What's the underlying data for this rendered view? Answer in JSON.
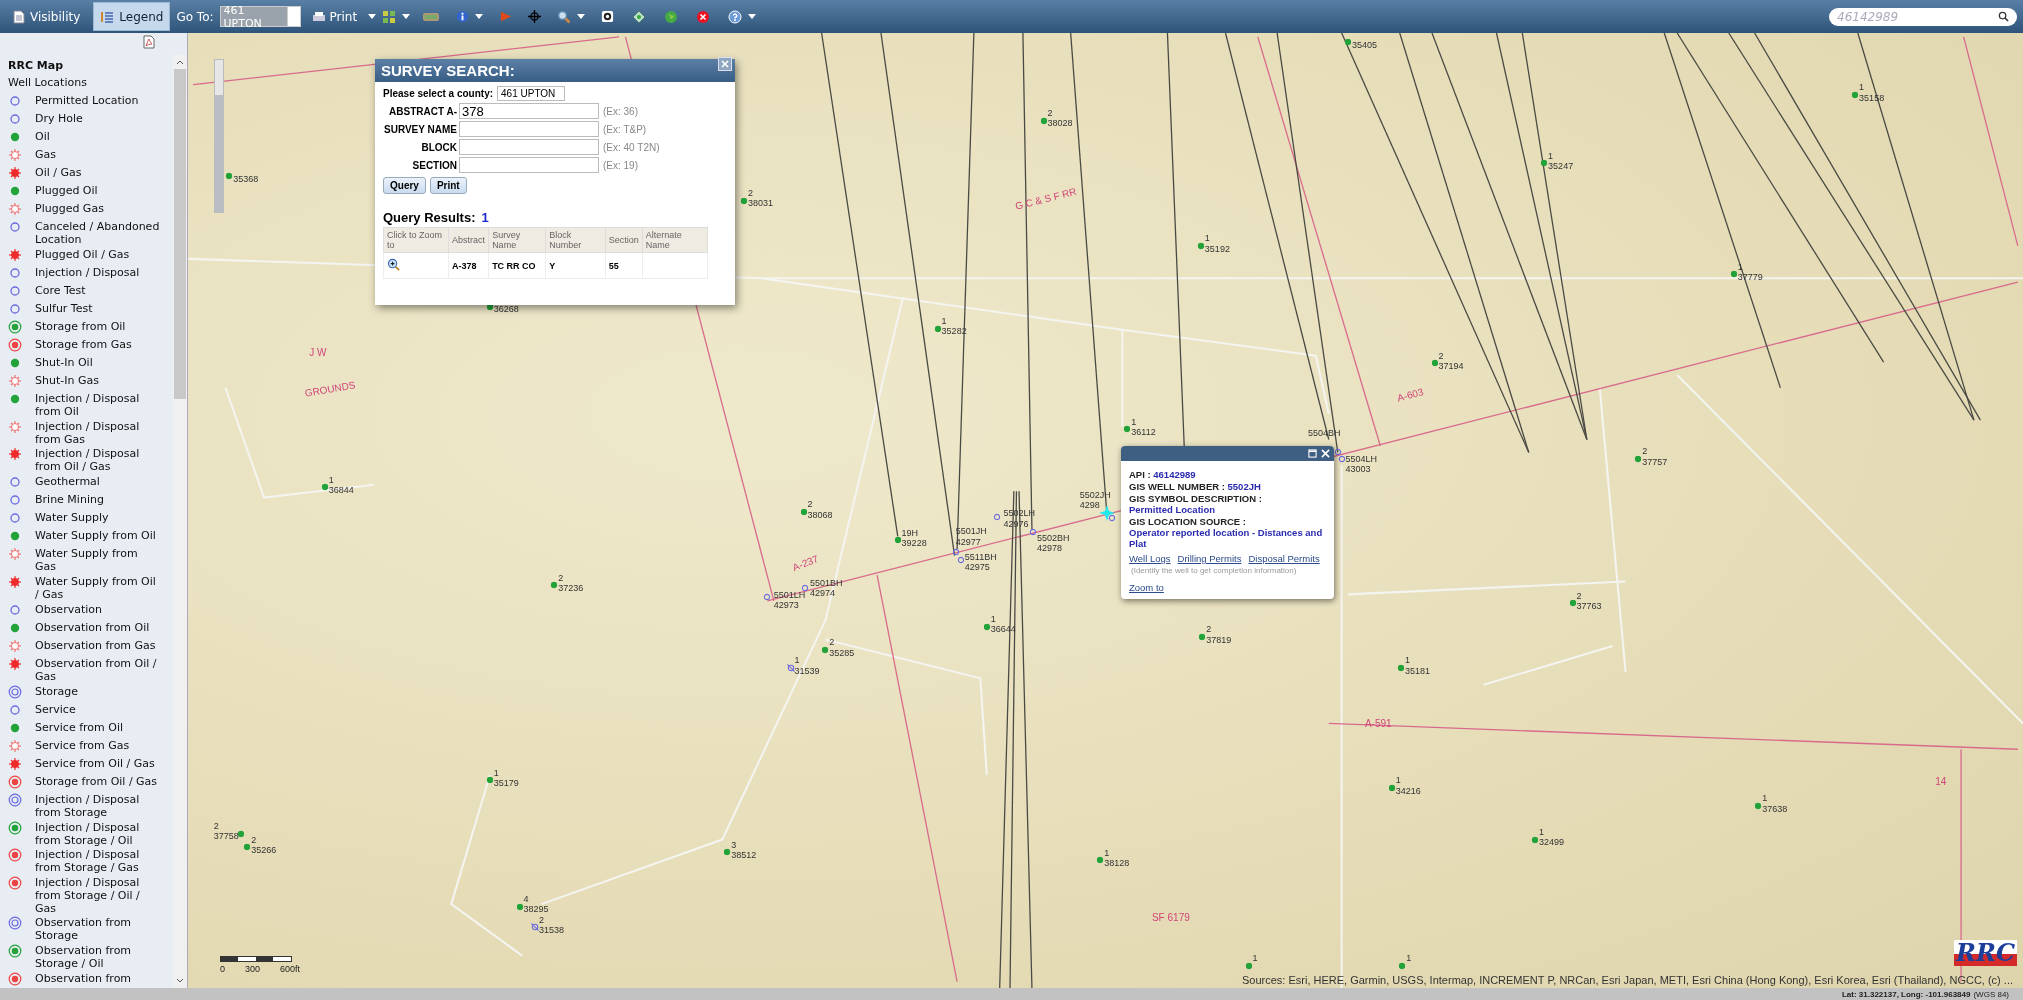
{
  "toolbar": {
    "tabs": [
      {
        "label": "Visibility",
        "selected": false
      },
      {
        "label": "Legend",
        "selected": true
      }
    ],
    "goto_label": "Go To:",
    "goto_value": "461 UPTON",
    "print_label": "Print",
    "search_value": "46142989"
  },
  "legend": {
    "title": "RRC Map",
    "group": "Well Locations",
    "items": [
      "Permitted Location",
      "Dry Hole",
      "Oil",
      "Gas",
      "Oil / Gas",
      "Plugged Oil",
      "Plugged Gas",
      "Canceled / Abandoned Location",
      "Plugged Oil / Gas",
      "Injection / Disposal",
      "Core Test",
      "Sulfur Test",
      "Storage from Oil",
      "Storage from Gas",
      "Shut-In Oil",
      "Shut-In Gas",
      "Injection / Disposal from Oil",
      "Injection / Disposal from Gas",
      "Injection / Disposal from Oil / Gas",
      "Geothermal",
      "Brine Mining",
      "Water Supply",
      "Water Supply from Oil",
      "Water Supply from Gas",
      "Water Supply from Oil / Gas",
      "Observation",
      "Observation from Oil",
      "Observation from Gas",
      "Observation from Oil / Gas",
      "Storage",
      "Service",
      "Service from Oil",
      "Service from Gas",
      "Service from Oil / Gas",
      "Storage from Oil / Gas",
      "Injection / Disposal from Storage",
      "Injection / Disposal from Storage / Oil",
      "Injection / Disposal from Storage / Gas",
      "Injection / Disposal from Storage / Oil / Gas",
      "Observation from Storage",
      "Observation from Storage / Oil",
      "Observation from"
    ]
  },
  "zoom_slider": {
    "level": 0.77
  },
  "survey_search": {
    "title": "SURVEY SEARCH:",
    "county_label": "Please select a county:",
    "county_value": "461 UPTON",
    "fields": [
      {
        "label": "ABSTRACT A-",
        "value": "378",
        "hint": "(Ex: 36)"
      },
      {
        "label": "SURVEY NAME",
        "hint": "(Ex: T&P)"
      },
      {
        "label": "BLOCK",
        "hint": "(Ex: 40 T2N)"
      },
      {
        "label": "SECTION",
        "hint": "(Ex: 19)"
      }
    ],
    "buttons": [
      "Query",
      "Print"
    ],
    "results_label": "Query Results:",
    "results_count": "1",
    "columns": [
      "Click to Zoom to",
      "Abstract",
      "Survey Name",
      "Block Number",
      "Section",
      "Alternate Name"
    ],
    "rows": [
      [
        "",
        "A-378",
        "TC RR CO",
        "Y",
        "55",
        ""
      ]
    ]
  },
  "popup": {
    "fields": [
      {
        "label": "API :",
        "value": "46142989"
      },
      {
        "label": "GIS WELL NUMBER :",
        "value": "5502JH"
      },
      {
        "label": "GIS SYMBOL DESCRIPTION :",
        "value": "Permitted Location"
      },
      {
        "label": "GIS LOCATION SOURCE :",
        "value": "Operator reported location - Distances and Plat"
      }
    ],
    "links": [
      "Well Logs",
      "Drilling Permits",
      "Disposal Permits"
    ],
    "note": "(Identify the well to get completion information)",
    "zoom_link": "Zoom to"
  },
  "map": {
    "wells": [
      {
        "kind": "oil",
        "id": "35405"
      },
      {
        "kind": "oil",
        "number": "1",
        "id": "35158"
      },
      {
        "kind": "oil",
        "number": "2",
        "id": "38028"
      },
      {
        "kind": "oil",
        "number": "2",
        "id": "38031"
      },
      {
        "kind": "oil",
        "number": "1",
        "id": "35247"
      },
      {
        "kind": "oil",
        "number": "1",
        "id": "35192"
      },
      {
        "kind": "oil",
        "id": "35368"
      },
      {
        "kind": "oil",
        "number": "1",
        "id": "37779"
      },
      {
        "kind": "oil",
        "id": "36268"
      },
      {
        "kind": "oil",
        "number": "1",
        "id": "35282"
      },
      {
        "kind": "oil",
        "number": "2",
        "id": "37194"
      },
      {
        "kind": "oil",
        "number": "1",
        "id": "36112"
      },
      {
        "kind": "oil",
        "number": "1",
        "id": "36844"
      },
      {
        "kind": "oil",
        "number": "2",
        "id": "37757"
      },
      {
        "kind": "oil",
        "number": "2",
        "id": "38068"
      },
      {
        "kind": "oil",
        "number": "19H",
        "id": "39228"
      },
      {
        "kind": "oil",
        "number": "2",
        "id": "37236"
      },
      {
        "kind": "oil",
        "number": "1",
        "id": "36644"
      },
      {
        "kind": "oil",
        "number": "2",
        "id": "37819"
      },
      {
        "kind": "oil",
        "number": "2",
        "id": "37763"
      },
      {
        "kind": "oil",
        "number": "2",
        "id": "35285"
      },
      {
        "kind": "canceled",
        "number": "1",
        "id": "31539"
      },
      {
        "kind": "oil",
        "number": "1",
        "id": "35181"
      },
      {
        "kind": "oil",
        "number": "1",
        "id": "35179"
      },
      {
        "kind": "oil",
        "number": "1",
        "id": "34216"
      },
      {
        "kind": "oil",
        "number": "1",
        "id": "37638"
      },
      {
        "kind": "oil",
        "number": "2",
        "id": "37758"
      },
      {
        "kind": "oil",
        "number": "2",
        "id": "35266"
      },
      {
        "kind": "oil",
        "number": "3",
        "id": "38512"
      },
      {
        "kind": "oil",
        "number": "1",
        "id": "32499"
      },
      {
        "kind": "oil",
        "number": "1",
        "id": "38128"
      },
      {
        "kind": "oil",
        "number": "4",
        "id": "38295"
      },
      {
        "kind": "canceled",
        "number": "2",
        "id": "31538"
      },
      {
        "kind": "oil",
        "number": "1"
      },
      {
        "kind": "oil",
        "number": "1"
      },
      {
        "kind": "permitted",
        "number": "5501LH",
        "id": "42973"
      },
      {
        "kind": "permitted",
        "number": "5501BH",
        "id": "42974"
      },
      {
        "kind": "permitted",
        "number": "5501JH",
        "id": "42977"
      },
      {
        "kind": "permitted",
        "number": "5511BH",
        "id": "42975"
      },
      {
        "kind": "permitted",
        "number": "5502LH",
        "id": "42976"
      },
      {
        "kind": "permitted",
        "number": "5502BH",
        "id": "42978"
      },
      {
        "kind": "permitted",
        "number": "5502JH",
        "id": "4298"
      },
      {
        "kind": "permitted",
        "number": "5504BH"
      },
      {
        "kind": "permitted",
        "number": "5504LH",
        "id": "43003"
      }
    ],
    "labels": [
      "G C & S F RR",
      "J W",
      "GROUNDS",
      "A-603",
      "A-237",
      "A-591",
      "SF 6179",
      "14"
    ],
    "scale_bar": [
      "0",
      "300",
      "600ft"
    ],
    "attribution": "Sources: Esri, HERE, Garmin, USGS, Intermap, INCREMENT P, NRCan, Esri Japan, METI, Esri China (Hong Kong), Esri Korea, Esri (Thailand), NGCC, (c) ...",
    "logo": "RRC"
  },
  "status_bar": {
    "coords": "Lat: 31.322137, Long: -101.963849",
    "datum": "(WGS 84)"
  }
}
